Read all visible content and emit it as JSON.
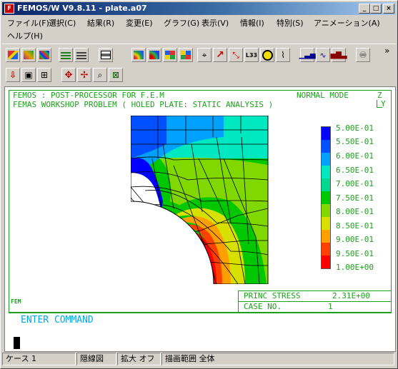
{
  "window": {
    "title": "FEMOS/W V9.8.11 - plate.a07",
    "icon": "femos-app-icon",
    "controls": {
      "minimize": "_",
      "maximize": "□",
      "close": "×"
    }
  },
  "menu": [
    {
      "label": "ファイル(F)"
    },
    {
      "label": "選択(C)"
    },
    {
      "label": "結果(R)"
    },
    {
      "label": "変更(E)"
    },
    {
      "label": "グラフ(G)"
    },
    {
      "label": "表示(V)"
    },
    {
      "label": "情報(I)"
    },
    {
      "label": "特別(S)"
    },
    {
      "label": "アニメーション(A)"
    },
    {
      "label": "ヘルプ(H)"
    }
  ],
  "toolbar": {
    "overflow": "»",
    "row1": [
      "open-model-icon",
      "color-model-icon",
      "mesh-color-icon",
      "layers-icon",
      "stack-icon",
      "print-icon",
      "contour-icon",
      "band-icon",
      "grid-color-icon",
      "element-color-icon",
      "axes-icon",
      "vector-arrow-icon",
      "deformed-vector-icon",
      "l33-icon",
      "circle-icon",
      "line-plot-icon",
      "bar-chart-icon",
      "wave-chart-icon",
      "column-chart-icon",
      "rotate-icon"
    ],
    "row2": [
      "down-arrow-icon",
      "node-down-icon",
      "node-select-icon",
      "select-icon",
      "move-icon",
      "zoom-icon",
      "fit-icon"
    ],
    "labels": {
      "l33": "L33"
    }
  },
  "graphics": {
    "header_left": "FEMOS  : POST-PROCESSOR  FOR F.E.M",
    "header_left2": "FEMAS WORKSHOP PROBLEM ( HOLED PLATE: STATIC ANALYSIS )",
    "mode": "NORMAL MODE",
    "axis_z": "Z",
    "axis_y": "Y",
    "info_label": "PRINC STRESS",
    "info_value": "2.31E+00",
    "case_label": "CASE NO.",
    "case_value": "1",
    "logo": "FEM",
    "command_prompt": "ENTER  COMMAND",
    "legend": [
      {
        "label": "5.00E-01",
        "color": "#0000ff"
      },
      {
        "label": "5.50E-01",
        "color": "#0050ff"
      },
      {
        "label": "6.00E-01",
        "color": "#00a0ff"
      },
      {
        "label": "6.50E-01",
        "color": "#00e8c0"
      },
      {
        "label": "7.00E-01",
        "color": "#00d890"
      },
      {
        "label": "7.50E-01",
        "color": "#00c800"
      },
      {
        "label": "8.00E-01",
        "color": "#80d800"
      },
      {
        "label": "8.50E-01",
        "color": "#d8e000"
      },
      {
        "label": "9.00E-01",
        "color": "#ffa000"
      },
      {
        "label": "9.50E-01",
        "color": "#ff4000"
      },
      {
        "label": "1.00E+00",
        "color": "#ff0000"
      }
    ]
  },
  "status": {
    "case": "ケース 1",
    "hidden_line": "隠線図",
    "zoom": "拡大 オフ",
    "draw_range": "描画範囲 全体"
  }
}
